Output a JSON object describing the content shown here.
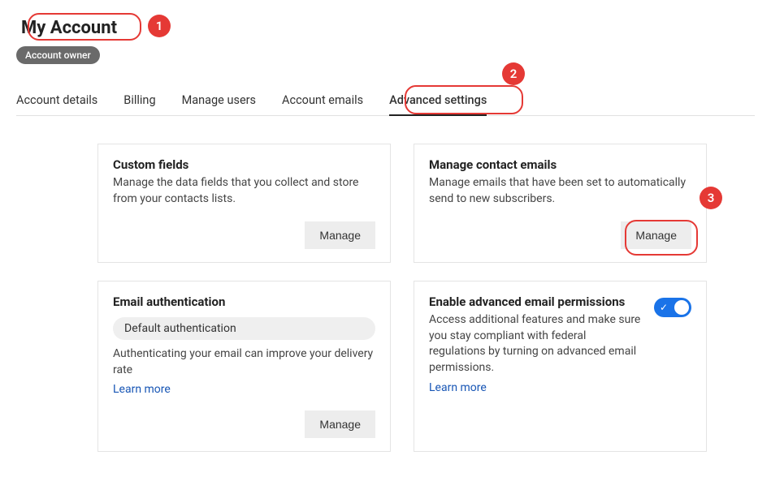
{
  "header": {
    "title": "My Account",
    "role_badge": "Account owner"
  },
  "tabs": [
    {
      "label": "Account details",
      "active": false
    },
    {
      "label": "Billing",
      "active": false
    },
    {
      "label": "Manage users",
      "active": false
    },
    {
      "label": "Account emails",
      "active": false
    },
    {
      "label": "Advanced settings",
      "active": true
    }
  ],
  "cards": {
    "custom_fields": {
      "title": "Custom fields",
      "desc": "Manage the data fields that you collect and store from your contacts lists.",
      "button": "Manage"
    },
    "contact_emails": {
      "title": "Manage contact emails",
      "desc": "Manage emails that have been set to automatically send to new subscribers.",
      "button": "Manage"
    },
    "email_auth": {
      "title": "Email authentication",
      "chip": "Default authentication",
      "desc": "Authenticating your email can improve your delivery rate",
      "learn": "Learn more",
      "button": "Manage"
    },
    "advanced_perms": {
      "title": "Enable advanced email permissions",
      "desc": "Access additional features and make sure you stay compliant with federal regulations by turning on advanced email permissions.",
      "learn": "Learn more",
      "toggle_on": true
    }
  },
  "annotations": {
    "n1": "1",
    "n2": "2",
    "n3": "3"
  }
}
